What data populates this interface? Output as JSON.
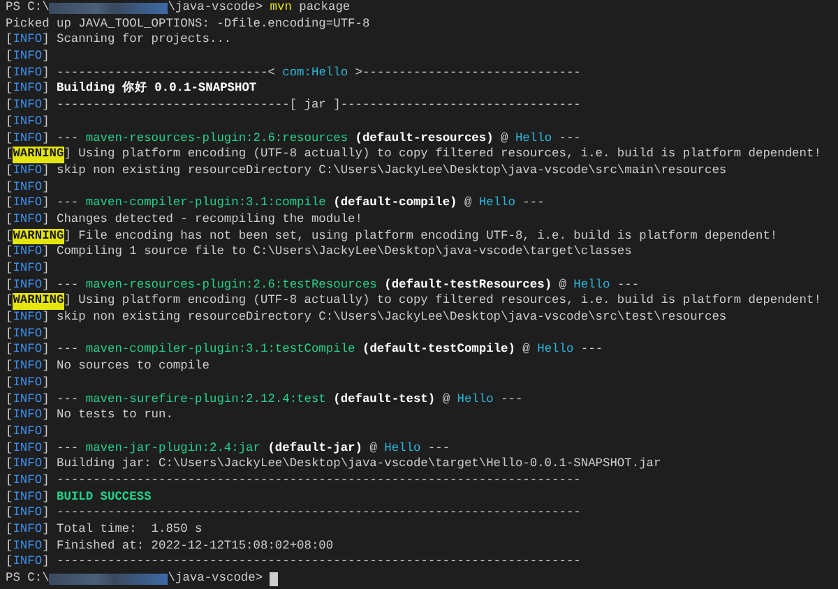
{
  "terminal": {
    "lines": [
      [
        {
          "kind": "text",
          "text": "PS C:\\"
        },
        {
          "kind": "redacted"
        },
        {
          "kind": "text",
          "text": "\\java-vscode> "
        },
        {
          "kind": "command",
          "text": "mvn"
        },
        {
          "kind": "text",
          "text": " package"
        }
      ],
      [
        {
          "kind": "text",
          "text": "Picked up JAVA_TOOL_OPTIONS: -Dfile.encoding=UTF-8"
        }
      ],
      [
        {
          "kind": "text",
          "text": "["
        },
        {
          "kind": "info",
          "text": "INFO"
        },
        {
          "kind": "text",
          "text": "] Scanning for projects..."
        }
      ],
      [
        {
          "kind": "text",
          "text": "["
        },
        {
          "kind": "info",
          "text": "INFO"
        },
        {
          "kind": "text",
          "text": "]"
        }
      ],
      [
        {
          "kind": "text",
          "text": "["
        },
        {
          "kind": "info",
          "text": "INFO"
        },
        {
          "kind": "text",
          "text": "] -----------------------------< "
        },
        {
          "kind": "project",
          "text": "com:Hello"
        },
        {
          "kind": "text",
          "text": " >------------------------------"
        }
      ],
      [
        {
          "kind": "text",
          "text": "["
        },
        {
          "kind": "info",
          "text": "INFO"
        },
        {
          "kind": "text",
          "text": "] "
        },
        {
          "kind": "bold",
          "text": "Building 你好 0.0.1-SNAPSHOT"
        }
      ],
      [
        {
          "kind": "text",
          "text": "["
        },
        {
          "kind": "info",
          "text": "INFO"
        },
        {
          "kind": "text",
          "text": "] --------------------------------[ jar ]---------------------------------"
        }
      ],
      [
        {
          "kind": "text",
          "text": "["
        },
        {
          "kind": "info",
          "text": "INFO"
        },
        {
          "kind": "text",
          "text": "]"
        }
      ],
      [
        {
          "kind": "text",
          "text": "["
        },
        {
          "kind": "info",
          "text": "INFO"
        },
        {
          "kind": "text",
          "text": "] --- "
        },
        {
          "kind": "plugin",
          "text": "maven-resources-plugin:2.6:resources"
        },
        {
          "kind": "bold",
          "text": " (default-resources)"
        },
        {
          "kind": "text",
          "text": " @ "
        },
        {
          "kind": "project",
          "text": "Hello"
        },
        {
          "kind": "text",
          "text": " ---"
        }
      ],
      [
        {
          "kind": "text",
          "text": "["
        },
        {
          "kind": "warning",
          "text": "WARNING"
        },
        {
          "kind": "text",
          "text": "] Using platform encoding (UTF-8 actually) to copy filtered resources, i.e. build is platform dependent!"
        }
      ],
      [
        {
          "kind": "text",
          "text": "["
        },
        {
          "kind": "info",
          "text": "INFO"
        },
        {
          "kind": "text",
          "text": "] skip non existing resourceDirectory C:\\Users\\JackyLee\\Desktop\\java-vscode\\src\\main\\resources"
        }
      ],
      [
        {
          "kind": "text",
          "text": "["
        },
        {
          "kind": "info",
          "text": "INFO"
        },
        {
          "kind": "text",
          "text": "]"
        }
      ],
      [
        {
          "kind": "text",
          "text": "["
        },
        {
          "kind": "info",
          "text": "INFO"
        },
        {
          "kind": "text",
          "text": "] --- "
        },
        {
          "kind": "plugin",
          "text": "maven-compiler-plugin:3.1:compile"
        },
        {
          "kind": "bold",
          "text": " (default-compile)"
        },
        {
          "kind": "text",
          "text": " @ "
        },
        {
          "kind": "project",
          "text": "Hello"
        },
        {
          "kind": "text",
          "text": " ---"
        }
      ],
      [
        {
          "kind": "text",
          "text": "["
        },
        {
          "kind": "info",
          "text": "INFO"
        },
        {
          "kind": "text",
          "text": "] Changes detected - recompiling the module!"
        }
      ],
      [
        {
          "kind": "text",
          "text": "["
        },
        {
          "kind": "warning",
          "text": "WARNING"
        },
        {
          "kind": "text",
          "text": "] File encoding has not been set, using platform encoding UTF-8, i.e. build is platform dependent!"
        }
      ],
      [
        {
          "kind": "text",
          "text": "["
        },
        {
          "kind": "info",
          "text": "INFO"
        },
        {
          "kind": "text",
          "text": "] Compiling 1 source file to C:\\Users\\JackyLee\\Desktop\\java-vscode\\target\\classes"
        }
      ],
      [
        {
          "kind": "text",
          "text": "["
        },
        {
          "kind": "info",
          "text": "INFO"
        },
        {
          "kind": "text",
          "text": "]"
        }
      ],
      [
        {
          "kind": "text",
          "text": "["
        },
        {
          "kind": "info",
          "text": "INFO"
        },
        {
          "kind": "text",
          "text": "] --- "
        },
        {
          "kind": "plugin",
          "text": "maven-resources-plugin:2.6:testResources"
        },
        {
          "kind": "bold",
          "text": " (default-testResources)"
        },
        {
          "kind": "text",
          "text": " @ "
        },
        {
          "kind": "project",
          "text": "Hello"
        },
        {
          "kind": "text",
          "text": " ---"
        }
      ],
      [
        {
          "kind": "text",
          "text": "["
        },
        {
          "kind": "warning",
          "text": "WARNING"
        },
        {
          "kind": "text",
          "text": "] Using platform encoding (UTF-8 actually) to copy filtered resources, i.e. build is platform dependent!"
        }
      ],
      [
        {
          "kind": "text",
          "text": "["
        },
        {
          "kind": "info",
          "text": "INFO"
        },
        {
          "kind": "text",
          "text": "] skip non existing resourceDirectory C:\\Users\\JackyLee\\Desktop\\java-vscode\\src\\test\\resources"
        }
      ],
      [
        {
          "kind": "text",
          "text": "["
        },
        {
          "kind": "info",
          "text": "INFO"
        },
        {
          "kind": "text",
          "text": "]"
        }
      ],
      [
        {
          "kind": "text",
          "text": "["
        },
        {
          "kind": "info",
          "text": "INFO"
        },
        {
          "kind": "text",
          "text": "] --- "
        },
        {
          "kind": "plugin",
          "text": "maven-compiler-plugin:3.1:testCompile"
        },
        {
          "kind": "bold",
          "text": " (default-testCompile)"
        },
        {
          "kind": "text",
          "text": " @ "
        },
        {
          "kind": "project",
          "text": "Hello"
        },
        {
          "kind": "text",
          "text": " ---"
        }
      ],
      [
        {
          "kind": "text",
          "text": "["
        },
        {
          "kind": "info",
          "text": "INFO"
        },
        {
          "kind": "text",
          "text": "] No sources to compile"
        }
      ],
      [
        {
          "kind": "text",
          "text": "["
        },
        {
          "kind": "info",
          "text": "INFO"
        },
        {
          "kind": "text",
          "text": "]"
        }
      ],
      [
        {
          "kind": "text",
          "text": "["
        },
        {
          "kind": "info",
          "text": "INFO"
        },
        {
          "kind": "text",
          "text": "] --- "
        },
        {
          "kind": "plugin",
          "text": "maven-surefire-plugin:2.12.4:test"
        },
        {
          "kind": "bold",
          "text": " (default-test)"
        },
        {
          "kind": "text",
          "text": " @ "
        },
        {
          "kind": "project",
          "text": "Hello"
        },
        {
          "kind": "text",
          "text": " ---"
        }
      ],
      [
        {
          "kind": "text",
          "text": "["
        },
        {
          "kind": "info",
          "text": "INFO"
        },
        {
          "kind": "text",
          "text": "] No tests to run."
        }
      ],
      [
        {
          "kind": "text",
          "text": "["
        },
        {
          "kind": "info",
          "text": "INFO"
        },
        {
          "kind": "text",
          "text": "]"
        }
      ],
      [
        {
          "kind": "text",
          "text": "["
        },
        {
          "kind": "info",
          "text": "INFO"
        },
        {
          "kind": "text",
          "text": "] --- "
        },
        {
          "kind": "plugin",
          "text": "maven-jar-plugin:2.4:jar"
        },
        {
          "kind": "bold",
          "text": " (default-jar)"
        },
        {
          "kind": "text",
          "text": " @ "
        },
        {
          "kind": "project",
          "text": "Hello"
        },
        {
          "kind": "text",
          "text": " ---"
        }
      ],
      [
        {
          "kind": "text",
          "text": "["
        },
        {
          "kind": "info",
          "text": "INFO"
        },
        {
          "kind": "text",
          "text": "] Building jar: C:\\Users\\JackyLee\\Desktop\\java-vscode\\target\\Hello-0.0.1-SNAPSHOT.jar"
        }
      ],
      [
        {
          "kind": "text",
          "text": "["
        },
        {
          "kind": "info",
          "text": "INFO"
        },
        {
          "kind": "text",
          "text": "] ------------------------------------------------------------------------"
        }
      ],
      [
        {
          "kind": "text",
          "text": "["
        },
        {
          "kind": "info",
          "text": "INFO"
        },
        {
          "kind": "text",
          "text": "] "
        },
        {
          "kind": "success",
          "text": "BUILD SUCCESS"
        }
      ],
      [
        {
          "kind": "text",
          "text": "["
        },
        {
          "kind": "info",
          "text": "INFO"
        },
        {
          "kind": "text",
          "text": "] ------------------------------------------------------------------------"
        }
      ],
      [
        {
          "kind": "text",
          "text": "["
        },
        {
          "kind": "info",
          "text": "INFO"
        },
        {
          "kind": "text",
          "text": "] Total time:  1.850 s"
        }
      ],
      [
        {
          "kind": "text",
          "text": "["
        },
        {
          "kind": "info",
          "text": "INFO"
        },
        {
          "kind": "text",
          "text": "] Finished at: 2022-12-12T15:08:02+08:00"
        }
      ],
      [
        {
          "kind": "text",
          "text": "["
        },
        {
          "kind": "info",
          "text": "INFO"
        },
        {
          "kind": "text",
          "text": "] ------------------------------------------------------------------------"
        }
      ],
      [
        {
          "kind": "text",
          "text": "PS C:\\"
        },
        {
          "kind": "redacted"
        },
        {
          "kind": "text",
          "text": "\\java-vscode> "
        },
        {
          "kind": "cursor"
        }
      ]
    ]
  }
}
